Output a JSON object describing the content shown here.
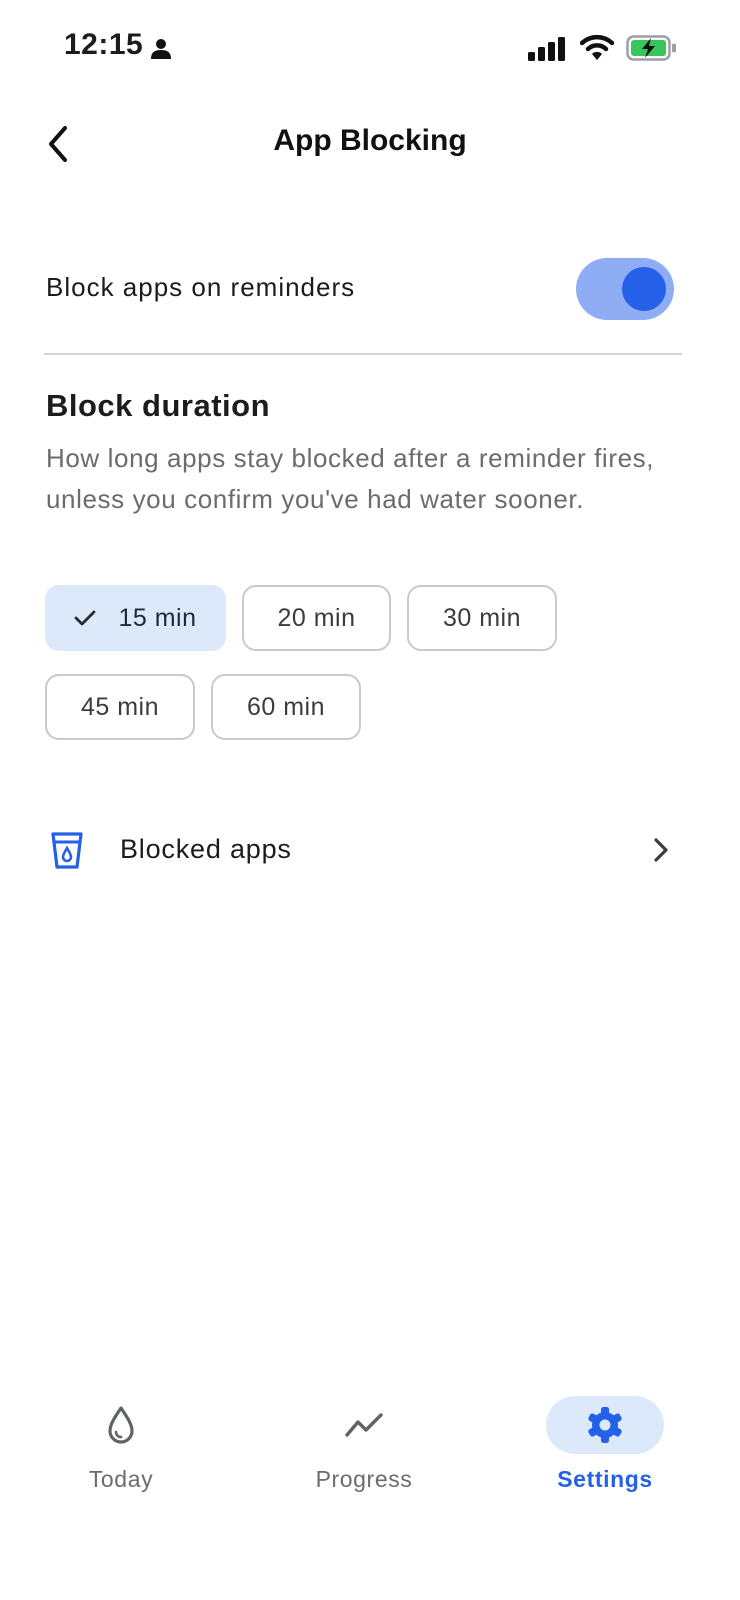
{
  "status_bar": {
    "time": "12:15",
    "icons": [
      "person-icon",
      "signal-icon",
      "wifi-icon",
      "battery-charging-icon"
    ]
  },
  "header": {
    "title": "App Blocking",
    "back_icon": "chevron-left-icon"
  },
  "block_toggle": {
    "label": "Block apps on reminders",
    "enabled": true
  },
  "duration": {
    "title": "Block duration",
    "description": "How long apps stay blocked after a reminder fires, unless you confirm you've had water sooner.",
    "options": [
      "15 min",
      "20 min",
      "30 min",
      "45 min",
      "60 min"
    ],
    "selected": "15 min"
  },
  "blocked_apps": {
    "label": "Blocked apps",
    "icon": "water-glass-icon"
  },
  "bottom_nav": {
    "items": [
      {
        "label": "Today",
        "icon": "water-drop-icon"
      },
      {
        "label": "Progress",
        "icon": "trend-icon"
      },
      {
        "label": "Settings",
        "icon": "gear-icon"
      }
    ],
    "active": "Settings"
  },
  "colors": {
    "accent": "#2460e8",
    "toggle_track": "#8fadf4",
    "selected_chip": "#dce9fb",
    "secondary_text": "#6b6b70"
  }
}
